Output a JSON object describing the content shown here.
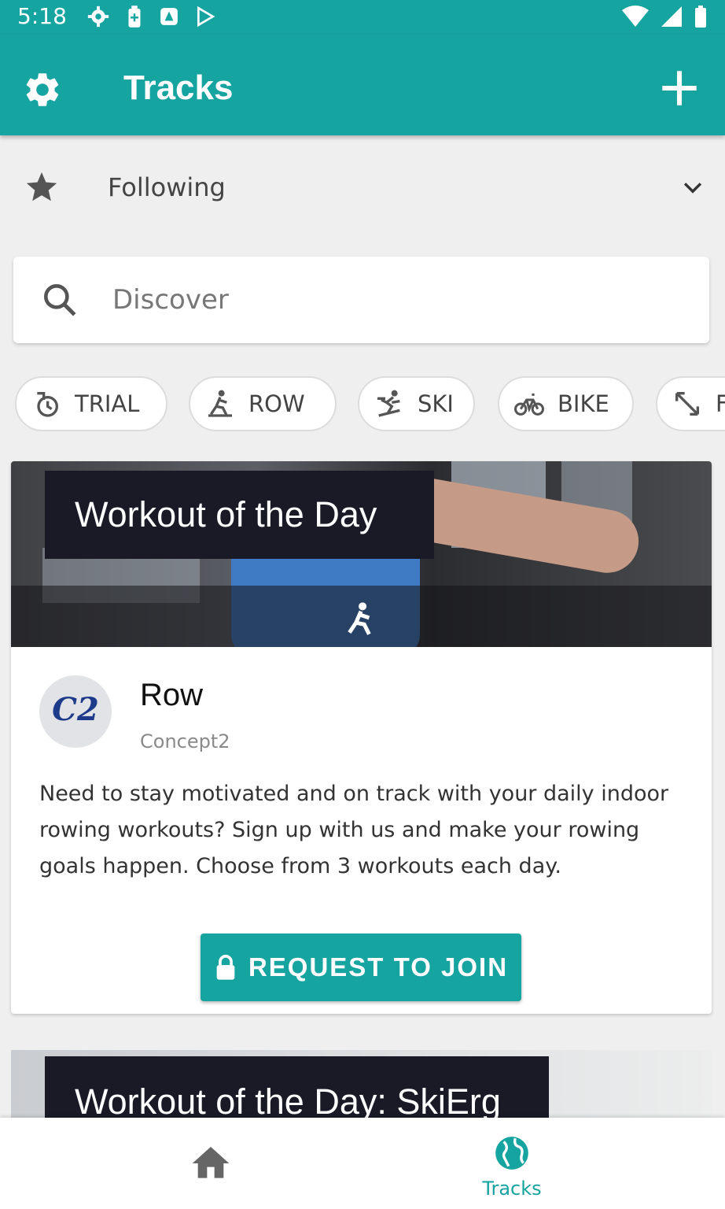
{
  "status_bar": {
    "time": "5:18"
  },
  "app_bar": {
    "title": "Tracks"
  },
  "filter": {
    "label": "Following"
  },
  "search": {
    "placeholder": "Discover"
  },
  "chips": [
    {
      "label": "TRIAL",
      "icon": "trial-timer-icon"
    },
    {
      "label": "ROW",
      "icon": "rower-icon"
    },
    {
      "label": "SKI",
      "icon": "skier-icon"
    },
    {
      "label": "BIKE",
      "icon": "bike-icon"
    },
    {
      "label": "F",
      "icon": "expand-arrows-icon"
    }
  ],
  "cards": [
    {
      "banner_title": "Workout of the Day",
      "logo_text": "C2",
      "title": "Row",
      "subtitle": "Concept2",
      "description": "Need to stay motivated and on track with your daily indoor rowing workouts? Sign up with us and make your rowing goals happen. Choose from 3 workouts each day.",
      "action_label": "REQUEST TO JOIN"
    },
    {
      "banner_title": "Workout of the Day: SkiErg"
    }
  ],
  "bottom_nav": {
    "items": [
      {
        "label": "",
        "icon": "home-icon"
      },
      {
        "label": "Tracks",
        "icon": "globe-icon"
      }
    ]
  },
  "colors": {
    "primary": "#16a4a0",
    "background": "#efefef",
    "banner_dark": "#191a26"
  }
}
